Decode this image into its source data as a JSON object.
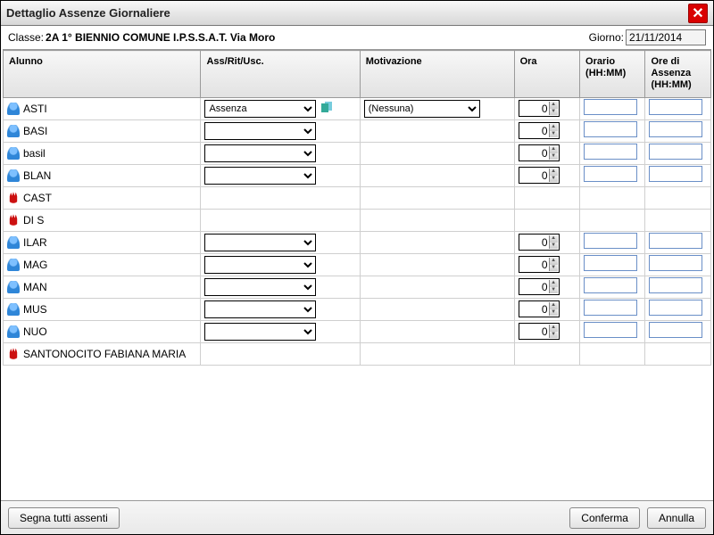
{
  "window": {
    "title": "Dettaglio Assenze Giornaliere"
  },
  "header": {
    "classe_label": "Classe:",
    "classe_value": "2A 1° BIENNIO COMUNE I.P.S.S.A.T. Via Moro",
    "giorno_label": "Giorno:",
    "giorno_value": "21/11/2014"
  },
  "columns": {
    "alunno": "Alunno",
    "ass": "Ass/Rit/Usc.",
    "mot": "Motivazione",
    "ora": "Ora",
    "orario": "Orario (HH:MM)",
    "ore_assenza": "Ore di Assenza (HH:MM)"
  },
  "options": {
    "ass_options": [
      "",
      "Assenza"
    ],
    "mot_options": [
      "(Nessuna)"
    ],
    "ass_selected_first": "Assenza",
    "mot_selected_first": "(Nessuna)"
  },
  "rows": [
    {
      "icon": "person",
      "name": "ASTI",
      "hasSelect": true,
      "ass": "Assenza",
      "hasCopy": true,
      "hasMot": true,
      "mot": "(Nessuna)",
      "ora": "0",
      "hasTxt": true
    },
    {
      "icon": "person",
      "name": "BASI",
      "hasSelect": true,
      "ass": "",
      "hasCopy": false,
      "hasMot": false,
      "ora": "0",
      "hasTxt": true
    },
    {
      "icon": "person",
      "name": "basil",
      "hasSelect": true,
      "ass": "",
      "hasCopy": false,
      "hasMot": false,
      "ora": "0",
      "hasTxt": true
    },
    {
      "icon": "person",
      "name": "BLAN",
      "hasSelect": true,
      "ass": "",
      "hasCopy": false,
      "hasMot": false,
      "ora": "0",
      "hasTxt": true
    },
    {
      "icon": "hand",
      "name": "CAST",
      "hasSelect": false,
      "hasCopy": false,
      "hasMot": false,
      "ora": "",
      "hasTxt": false
    },
    {
      "icon": "hand",
      "name": "DI S",
      "hasSelect": false,
      "hasCopy": false,
      "hasMot": false,
      "ora": "",
      "hasTxt": false
    },
    {
      "icon": "person",
      "name": "ILAR",
      "hasSelect": true,
      "ass": "",
      "hasCopy": false,
      "hasMot": false,
      "ora": "0",
      "hasTxt": true
    },
    {
      "icon": "person",
      "name": "MAG",
      "hasSelect": true,
      "ass": "",
      "hasCopy": false,
      "hasMot": false,
      "ora": "0",
      "hasTxt": true
    },
    {
      "icon": "person",
      "name": "MAN",
      "hasSelect": true,
      "ass": "",
      "hasCopy": false,
      "hasMot": false,
      "ora": "0",
      "hasTxt": true
    },
    {
      "icon": "person",
      "name": "MUS",
      "hasSelect": true,
      "ass": "",
      "hasCopy": false,
      "hasMot": false,
      "ora": "0",
      "hasTxt": true
    },
    {
      "icon": "person",
      "name": "NUO",
      "hasSelect": true,
      "ass": "",
      "hasCopy": false,
      "hasMot": false,
      "ora": "0",
      "hasTxt": true
    },
    {
      "icon": "hand",
      "name": "SANTONOCITO FABIANA MARIA",
      "fullwidth": true,
      "hasSelect": false,
      "hasCopy": false,
      "hasMot": false,
      "ora": "",
      "hasTxt": false
    }
  ],
  "footer": {
    "mark_all": "Segna tutti assenti",
    "confirm": "Conferma",
    "cancel": "Annulla"
  }
}
